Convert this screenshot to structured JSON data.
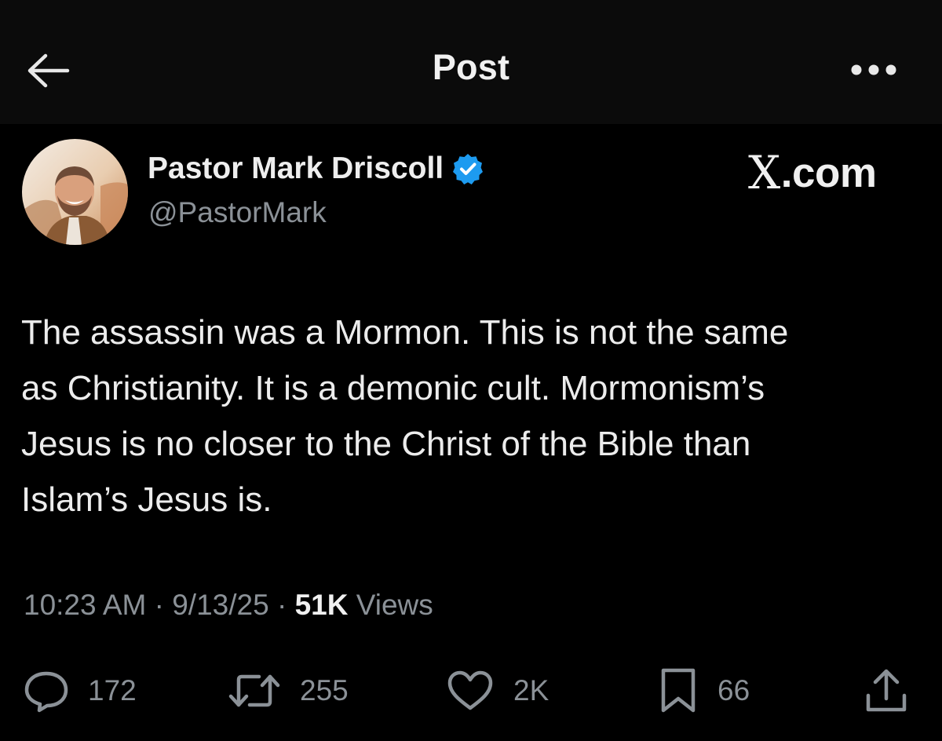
{
  "header": {
    "title": "Post",
    "back_icon": "arrow-left-icon",
    "more_icon": "more-horizontal-icon"
  },
  "author": {
    "name": "Pastor Mark Driscoll",
    "handle": "@PastorMark",
    "verified": true,
    "verified_color": "#1d9bf0"
  },
  "watermark": {
    "x": "X",
    "rest": ".com"
  },
  "post": {
    "text": "The assassin was a Mormon. This is not the same\nas Christianity. It is a demonic cult. Mormonism’s\nJesus is no closer to the Christ of the Bible than\nIslam’s Jesus is."
  },
  "meta": {
    "time": "10:23 AM",
    "date": "9/13/25",
    "separator": "·",
    "views_count": "51K",
    "views_label": "Views"
  },
  "actions": {
    "replies": "172",
    "reposts": "255",
    "likes": "2K",
    "bookmarks": "66"
  },
  "colors": {
    "background": "#000000",
    "text": "#e7e9ea",
    "secondary": "#8b9197",
    "accent": "#1d9bf0"
  }
}
